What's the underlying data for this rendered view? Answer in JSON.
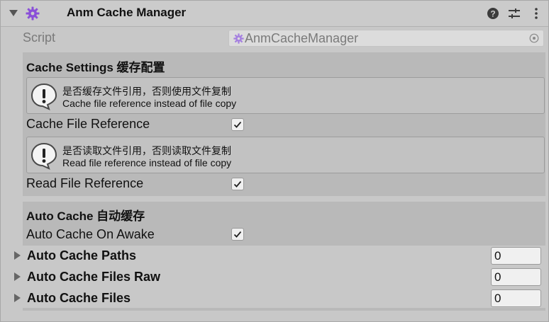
{
  "component": {
    "title": "Anm Cache Manager",
    "icon": "gear-icon",
    "accent_color": "#8a4fd8"
  },
  "header_icons": [
    "help-icon",
    "preset-sliders-icon",
    "more-vert-icon"
  ],
  "script": {
    "label": "Script",
    "value": "AnmCacheManager"
  },
  "cache_settings": {
    "title": "Cache Settings 缓存配置",
    "help1": {
      "line1": "是否缓存文件引用，否则使用文件复制",
      "line2": "Cache file reference instead of file copy"
    },
    "cache_file_reference": {
      "label": "Cache File Reference",
      "checked": true
    },
    "help2": {
      "line1": "是否读取文件引用，否则读取文件复制",
      "line2": "Read file reference instead of file copy"
    },
    "read_file_reference": {
      "label": "Read File Reference",
      "checked": true
    }
  },
  "auto_cache": {
    "title": "Auto Cache 自动缓存",
    "auto_cache_on_awake": {
      "label": "Auto Cache On Awake",
      "checked": true
    },
    "arrays": [
      {
        "label": "Auto Cache Paths",
        "size": "0"
      },
      {
        "label": "Auto Cache Files Raw",
        "size": "0"
      },
      {
        "label": "Auto Cache Files",
        "size": "0"
      }
    ]
  }
}
